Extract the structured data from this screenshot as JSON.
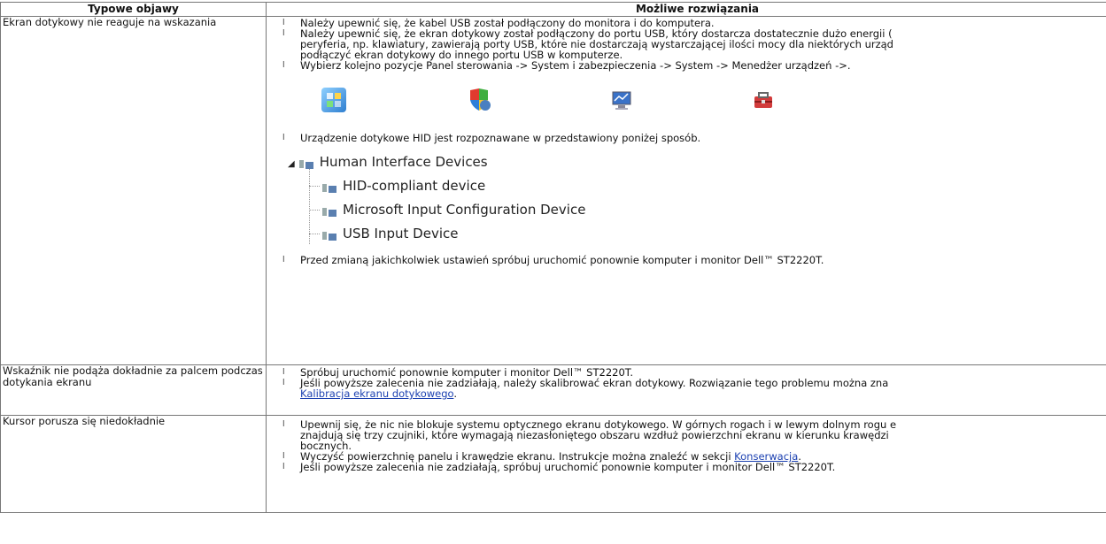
{
  "headers": {
    "col1": "Typowe objawy",
    "col2": "Możliwe rozwiązania"
  },
  "rows": [
    {
      "symptom": "Ekran dotykowy nie reaguje na wskazania",
      "bullet": "l",
      "items": [
        "Należy upewnić się, że kabel USB został podłączony do monitora i do komputera.",
        "Należy upewnić się, że ekran dotykowy został podłączony do portu USB, który dostarcza dostatecznie dużo energii (",
        "peryferia, np. klawiatury, zawierają porty USB, które nie dostarczają wystarczającej ilości mocy dla niektórych urząd",
        "podłączyć ekran dotykowy do innego portu USB w komputerze.",
        "Wybierz kolejno pozycje Panel sterowania -> System i zabezpieczenia -> System -> Menedżer urządzeń ->.",
        "Urządzenie dotykowe HID jest rozpoznawane w przedstawiony poniżej sposób.",
        "Przed zmianą jakichkolwiek ustawień spróbuj uruchomić ponownie komputer i monitor Dell™ ST2220T."
      ],
      "icons": [
        "control-panel-icon",
        "security-shield-icon",
        "system-computer-icon",
        "toolbox-icon"
      ],
      "device_tree": {
        "root": "Human Interface Devices",
        "children": [
          "HID-compliant device",
          "Microsoft Input Configuration Device",
          "USB Input Device"
        ]
      }
    },
    {
      "symptom": "Wskaźnik nie podąża dokładnie za palcem podczas dotykania ekranu",
      "items": [
        "Spróbuj uruchomić ponownie komputer i monitor Dell™ ST2220T.",
        "Jeśli powyższe zalecenia nie zadziałają, należy skalibrować ekran dotykowy. Rozwiązanie tego problemu można zna"
      ],
      "link": "Kalibracja ekranu dotykowego",
      "link_suffix": "."
    },
    {
      "symptom": "Kursor porusza się niedokładnie",
      "items": [
        "Upewnij się, że nic nie blokuje systemu optycznego ekranu dotykowego. W górnych rogach i w lewym dolnym rogu e",
        "znajdują się trzy czujniki, które wymagają niezasłoniętego obszaru wzdłuż powierzchni ekranu w kierunku krawędzi",
        "bocznych.",
        "Wyczyść powierzchnię panelu i krawędzie ekranu. Instrukcje można znaleźć w sekcji ",
        "Jeśli powyższe zalecenia nie zadziałają, spróbuj uruchomić ponownie komputer i monitor Dell™ ST2220T."
      ],
      "link": "Konserwacja",
      "link_suffix": "."
    }
  ]
}
